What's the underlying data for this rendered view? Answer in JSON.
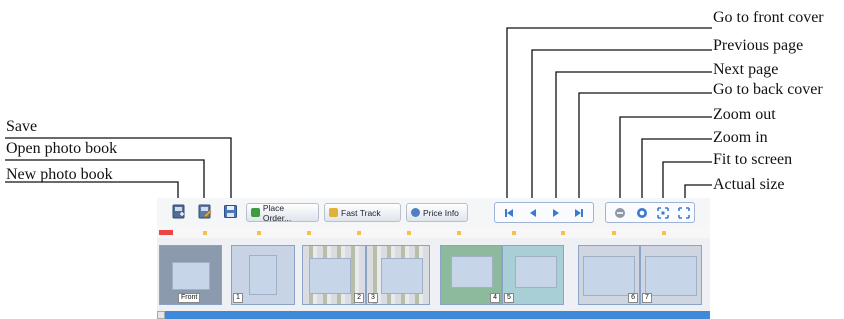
{
  "labels": {
    "save": "Save",
    "open": "Open photo book",
    "new": "New photo book",
    "front": "Go to front cover",
    "prev": "Previous page",
    "next": "Next page",
    "back": "Go to back cover",
    "zoom_out": "Zoom out",
    "zoom_in": "Zoom in",
    "fit": "Fit to screen",
    "actual": "Actual size"
  },
  "toolbar": {
    "place_order": "Place Order...",
    "fast_track": "Fast Track",
    "price_info": "Price Info"
  },
  "pages": {
    "front": "Front",
    "p1": "1",
    "p2": "2",
    "p3": "3",
    "p4": "4",
    "p5": "5",
    "p6": "6",
    "p7": "7"
  },
  "colors": {
    "accent": "#3e8ad8",
    "nav": "#3b7ad0"
  },
  "icons": [
    "new-book-icon",
    "open-book-icon",
    "save-icon",
    "first-page-icon",
    "prev-page-icon",
    "next-page-icon",
    "last-page-icon",
    "zoom-out-icon",
    "zoom-in-icon",
    "fit-screen-icon",
    "actual-size-icon"
  ]
}
